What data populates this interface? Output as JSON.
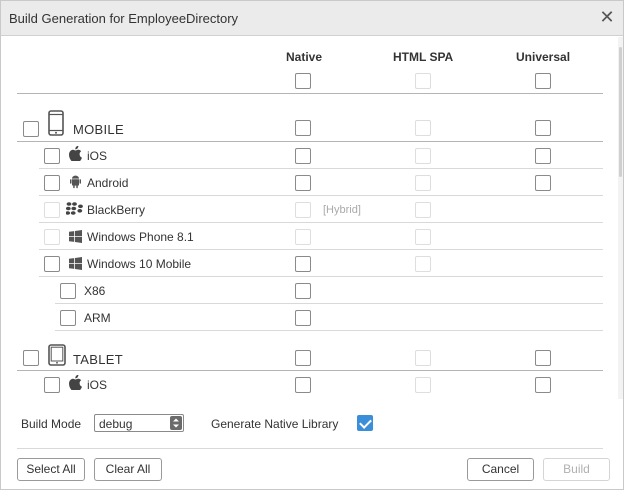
{
  "window": {
    "title": "Build Generation for EmployeeDirectory"
  },
  "columns": {
    "native": "Native",
    "html_spa": "HTML SPA",
    "universal": "Universal"
  },
  "groups": {
    "mobile": {
      "label": "MOBILE",
      "platforms": {
        "ios": "iOS",
        "android": "Android",
        "blackberry": "BlackBerry",
        "blackberry_note": "[Hybrid]",
        "winphone": "Windows Phone 8.1",
        "win10mobile": "Windows 10 Mobile",
        "x86": "X86",
        "arm": "ARM"
      }
    },
    "tablet": {
      "label": "TABLET",
      "platforms": {
        "ios": "iOS"
      }
    }
  },
  "footer": {
    "build_mode_label": "Build Mode",
    "build_mode_value": "debug",
    "gen_native_label": "Generate Native Library",
    "gen_native_checked": true
  },
  "buttons": {
    "select_all": "Select All",
    "clear_all": "Clear All",
    "cancel": "Cancel",
    "build": "Build"
  }
}
